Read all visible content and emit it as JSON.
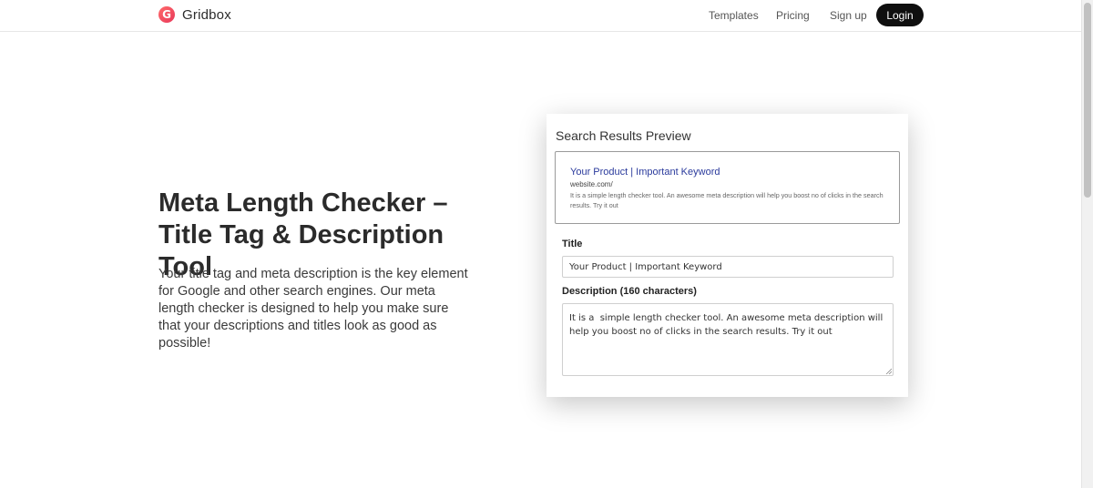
{
  "header": {
    "brand_name": "Gridbox",
    "brand_logo_letter": "G",
    "nav": {
      "templates": "Templates",
      "pricing": "Pricing",
      "signup": "Sign up",
      "login": "Login"
    }
  },
  "hero": {
    "title": "Meta Length Checker – Title Tag & Description Tool",
    "description": "Your title tag and meta description is the key element for Google and other search engines. Our meta length checker is designed to help you make sure that your descriptions and titles look as good as possible!"
  },
  "preview": {
    "heading": "Search Results Preview",
    "title": "Your Product | Important Keyword",
    "url": "website.com/",
    "description": "It is a simple length checker tool. An awesome meta description will help you boost no of clicks in the search results. Try it out"
  },
  "form": {
    "title_label": "Title",
    "title_value": "Your Product | Important Keyword",
    "description_label": "Description (160 characters)",
    "description_value": "It is a  simple length checker tool. An awesome meta description will help you boost no of clicks in the search results. Try it out"
  },
  "colors": {
    "brand_accent": "#e8385a",
    "login_bg": "#0f0f0f",
    "preview_link": "#2a3a9c"
  },
  "icons": {
    "brand_logo": "gridbox-logo-icon",
    "resize_handle": "resize-grip-icon"
  }
}
